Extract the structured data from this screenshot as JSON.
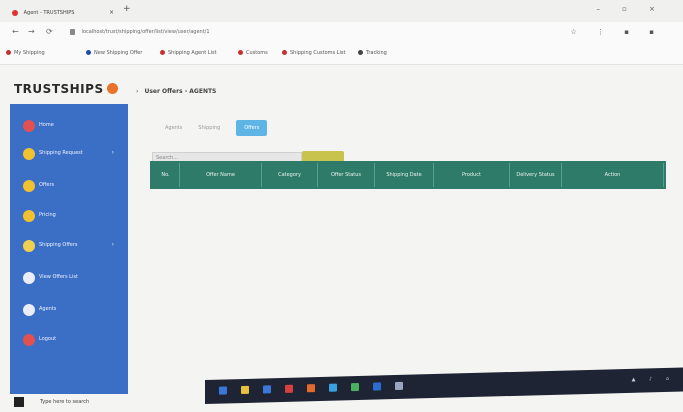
{
  "browser": {
    "tab_title": "Agent - TRUSTSHIPS",
    "tab_close": "×",
    "new_tab": "+",
    "window_controls": "– ▫ ×",
    "nav": {
      "back": "←",
      "forward": "→",
      "reload": "⟳"
    },
    "url": "localhost/trust/shipping/offer/list/view/user/agent/1",
    "toolbar_right": "☆ ⋮ ▪ ▪",
    "bookmarks": [
      {
        "label": "My Shipping",
        "color": "#c93030"
      },
      {
        "label": "New Shipping Offer",
        "color": "#1e4da8"
      },
      {
        "label": "Shipping Agent List",
        "color": "#c93030"
      },
      {
        "label": "Customs",
        "color": "#c93030"
      },
      {
        "label": "Shipping Customs List",
        "color": "#c93030"
      },
      {
        "label": "Tracking",
        "color": "#444444"
      }
    ]
  },
  "app": {
    "logo_text": "TRUSTSHIPS",
    "breadcrumb_arrow": "›",
    "breadcrumb": "User Offers - AGENTS"
  },
  "sidebar": {
    "items": [
      {
        "label": "Home",
        "icon": "home-icon",
        "color": "#e35050",
        "chevron": ""
      },
      {
        "label": "Shipping Request",
        "icon": "folder-icon",
        "color": "#f0c230",
        "chevron": "›"
      },
      {
        "label": "Offers",
        "icon": "folder-icon",
        "color": "#f0c230",
        "chevron": ""
      },
      {
        "label": "Pricing",
        "icon": "folder-icon",
        "color": "#f0c230",
        "chevron": ""
      },
      {
        "label": "Shipping Offers",
        "icon": "document-icon",
        "color": "#f0d050",
        "chevron": "›"
      },
      {
        "label": "View Offers List",
        "icon": "list-icon",
        "color": "#e8edf8",
        "chevron": ""
      },
      {
        "label": "Agents",
        "icon": "document-icon",
        "color": "#e8edf8",
        "chevron": ""
      },
      {
        "label": "Logout",
        "icon": "logout-icon",
        "color": "#e35050",
        "chevron": ""
      }
    ]
  },
  "main": {
    "filters": [
      {
        "label": "Agents",
        "active": false
      },
      {
        "label": "Shipping",
        "active": false
      },
      {
        "label": "Offers",
        "active": true
      }
    ],
    "search_placeholder": "Search...",
    "columns": [
      "No.",
      "Offer Name",
      "Category",
      "Offer Status",
      "Shipping Date",
      "Product",
      "Delivery Status",
      "Action"
    ]
  },
  "os": {
    "cortana_placeholder": "Type here to search",
    "taskbar_icons": [
      "#3a78d8",
      "#e8c040",
      "#3a78d8",
      "#d84040",
      "#e36a2a",
      "#3aa0e0",
      "#4ab060",
      "#2a6fd0",
      "#9aa6c0"
    ],
    "tray": "▲ ♪ ⌂"
  }
}
